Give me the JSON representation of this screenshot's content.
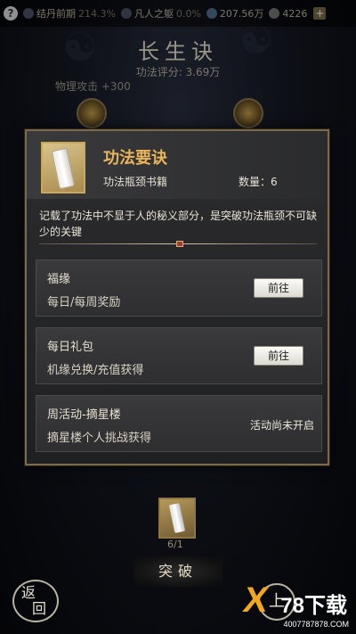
{
  "topbar": {
    "help_icon": "?",
    "items": [
      {
        "icon": "pill-icon",
        "label": "结丹前期",
        "value": "214.3%"
      },
      {
        "icon": "figure-icon",
        "label": "凡人之躯",
        "value": "0.0%"
      },
      {
        "icon": "crystal-icon",
        "label": "",
        "value": "207.56万"
      },
      {
        "icon": "coin-icon",
        "label": "",
        "value": "4226"
      }
    ],
    "plus": "+"
  },
  "page": {
    "title": "长生诀",
    "score": "功法评分: 3.69万",
    "stat": "物理攻击 +300"
  },
  "modal": {
    "item_name": "功法要诀",
    "item_type": "功法瓶颈书籍",
    "item_qty": "数量：6",
    "description": "记载了功法中不显于人的秘义部分，是突破功法瓶颈不可缺少的关键",
    "sources": [
      {
        "title": "福缘",
        "desc": "每日/每周奖励",
        "action": "前往"
      },
      {
        "title": "每日礼包",
        "desc": "机缘兑换/充值获得",
        "action": "前往"
      },
      {
        "title": "周活动-摘星楼",
        "desc": "摘星楼个人挑战获得",
        "status": "活动尚未开启"
      }
    ]
  },
  "bottom": {
    "count": "6/1",
    "break_label": "突破",
    "back_label_top": "返",
    "back_label_bottom": "回",
    "go_label": "上"
  },
  "watermark": {
    "logo": "78下载",
    "url": "4007787878.COM"
  },
  "colors": {
    "accent_gold": "#e9b55a",
    "border": "#7b6a4a",
    "logo_orange": "#f2a81c"
  }
}
